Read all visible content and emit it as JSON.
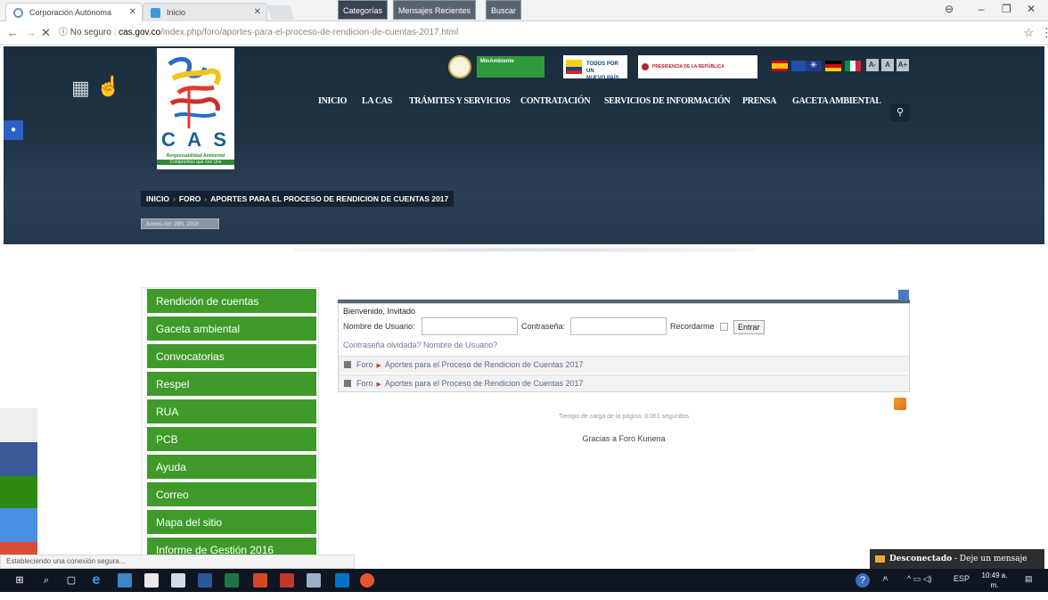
{
  "browser": {
    "tabs": [
      {
        "title": "Corporación Autónoma",
        "active": true
      },
      {
        "title": "Inicio",
        "active": false
      }
    ],
    "address": {
      "security": "No seguro",
      "domain": "cas.gov.co",
      "path": "/index.php/foro/aportes-para-el-proceso-de-rendicion-de-cuentas-2017.html"
    }
  },
  "header": {
    "logo_text": "C A S",
    "logo_tagline1": "Responsabilidad Ambiental",
    "logo_tagline2": "Compromiso que nos Une",
    "badges": {
      "minambiente": "MinAmbiente",
      "todos_por_un": "TODOS POR UN",
      "nuevo_pais": "NUEVO PAÍS",
      "presidencia": "PRESIDENCIA DE LA REPÚBLICA"
    },
    "font_sizes": [
      "A-",
      "A",
      "A+"
    ],
    "nav": [
      "INICIO",
      "LA CAS",
      "TRÁMITES Y SERVICIOS",
      "CONTRATACIÓN",
      "SERVICIOS DE INFORMACIÓN",
      "PRENSA",
      "GACETA AMBIENTAL"
    ],
    "breadcrumb": [
      "INICIO",
      "FORO",
      "APORTES PARA EL PROCESO DE RENDICION DE CUENTAS 2017"
    ],
    "date": "Jueves Abr 19th, 2018"
  },
  "sidebar": {
    "items": [
      "Rendición de cuentas",
      "Gaceta ambiental",
      "Convocatorias",
      "Respel",
      "RUA",
      "PCB",
      "Ayuda",
      "Correo",
      "Mapa del sitio",
      "Informe de Gestión 2016"
    ]
  },
  "forum": {
    "tabs": [
      "Categorías",
      "Mensajes Recientes",
      "Buscar"
    ],
    "welcome": "Bienvenido, Invitado",
    "username_label": "Nombre de Usuario:",
    "password_label": "Contraseña:",
    "remember_label": "Recordarme",
    "login_button": "Entrar",
    "forgot_links": "Contraseña olvidada? Nombre de Usuario?",
    "trail": [
      {
        "root": "Foro",
        "page": "Aportes para el Proceso de Rendicion de Cuentas 2017"
      },
      {
        "root": "Foro",
        "page": "Aportes para el Proceso de Rendicion de Cuentas 2017"
      }
    ],
    "load_time": "Tiempo de carga de la página: 0.061 segundos",
    "credits": "Gracias a Foro Kunena"
  },
  "status_text": "Estableciendo una conexión segura...",
  "chat": {
    "status": "Desconectado",
    "action": "- Deje un mensaje"
  },
  "taskbar": {
    "language": "ESP",
    "time": "10:49 a. m.",
    "date": "19/04/2018"
  }
}
